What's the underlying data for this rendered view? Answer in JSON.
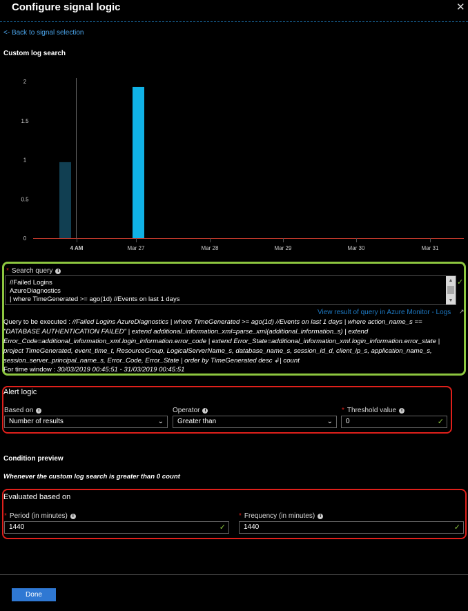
{
  "header": {
    "title": "Configure signal logic",
    "close_label": "✕"
  },
  "back_link": "<- Back to signal selection",
  "section_title": "Custom log search",
  "chart_data": {
    "type": "bar",
    "y_ticks": [
      "2",
      "1.5",
      "1",
      "0.5",
      "0"
    ],
    "x_labels": [
      "4 AM",
      "Mar 27",
      "Mar 28",
      "Mar 29",
      "Mar 30",
      "Mar 31"
    ],
    "ylim": [
      0,
      2
    ],
    "bars": [
      {
        "x": "Mar 26 (late)",
        "value": 0.97,
        "color": "#113f52"
      },
      {
        "x": "Mar 27",
        "value": 1.93,
        "color": "#10b2e6"
      }
    ],
    "grid": false
  },
  "search_query": {
    "label": "Search query",
    "lines": [
      "//Failed Logins",
      "AzureDiagnostics",
      "| where TimeGenerated >= ago(1d) //Events on last 1 days"
    ],
    "view_link": "View result of query in Azure Monitor - Logs"
  },
  "query_preview": {
    "prefix": "Query to be executed : ",
    "line1": "//Failed Logins AzureDiagnostics | where TimeGenerated >= ago(1d) //Events on last 1 days | where action_name_s ==",
    "line2": "\"DATABASE AUTHENTICATION FAILED\"  | extend additional_information_xml=parse_xml(additional_information_s) | extend",
    "line3": "Error_Code=additional_information_xml.login_information.error_code | extend Error_State=additional_information_xml.login_information.error_state |",
    "line4": "project  TimeGenerated, event_time_t, ResourceGroup, LogicalServerName_s, database_name_s, session_id_d, client_ip_s, application_name_s,",
    "line5": "session_server_principal_name_s, Error_Code, Error_State | order by TimeGenerated desc ↲| count",
    "window_prefix": "For time window : ",
    "window_value": "30/03/2019 00:45:51 - 31/03/2019 00:45:51"
  },
  "alert_logic": {
    "title": "Alert logic",
    "based_on_label": "Based on",
    "based_on_value": "Number of results",
    "operator_label": "Operator",
    "operator_value": "Greater than",
    "threshold_label": "Threshold value",
    "threshold_value": "0"
  },
  "condition_preview": {
    "title": "Condition preview",
    "text": "Whenever the custom log search is greater than 0 count"
  },
  "evaluated": {
    "title": "Evaluated based on",
    "period_label": "Period (in minutes)",
    "period_value": "1440",
    "frequency_label": "Frequency (in minutes)",
    "frequency_value": "1440"
  },
  "footer": {
    "done_label": "Done"
  },
  "colors": {
    "accent_link": "#4aa3e8",
    "valid_green": "#8dc63f",
    "required_red": "#e0201b",
    "done_blue": "#2f78d3"
  }
}
